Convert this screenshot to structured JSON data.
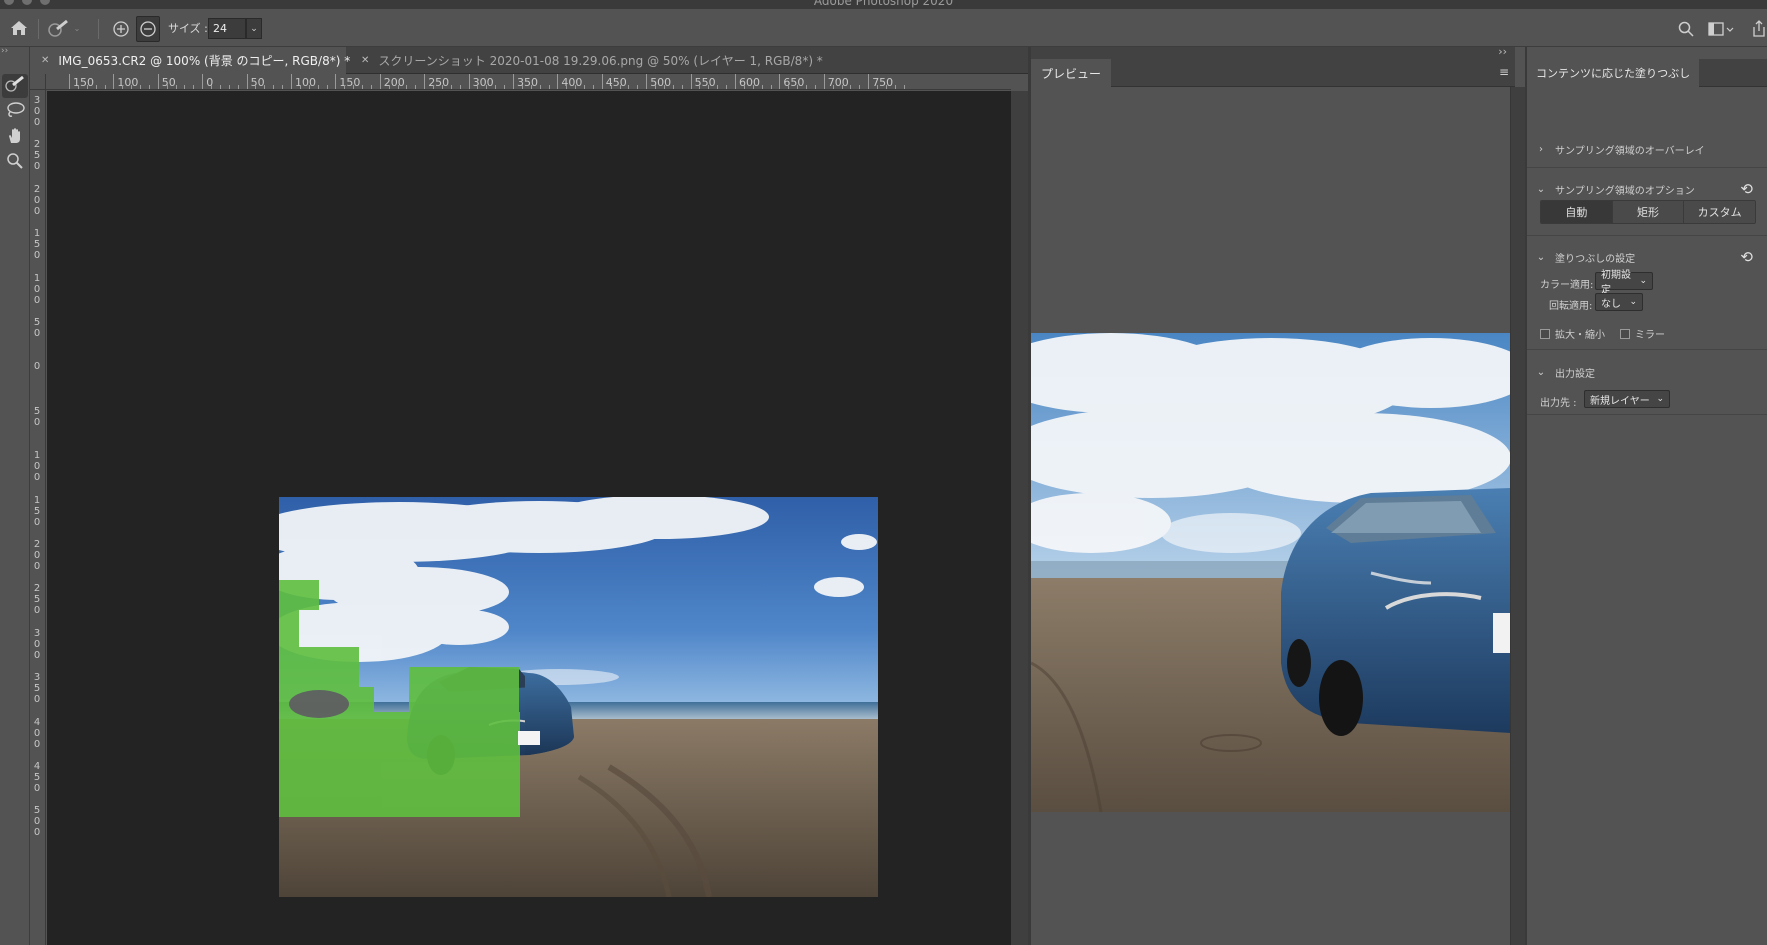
{
  "window": {
    "title": "Adobe Photoshop 2020"
  },
  "options_bar": {
    "home_icon": "home-icon",
    "brush_preset_icon": "brush-preset-icon",
    "add_mode_icon": "add-to-selection-icon",
    "subtract_mode_icon": "subtract-from-selection-icon",
    "size_label": "サイズ :",
    "size_value": "24",
    "search_icon": "search-icon",
    "workspace_icon": "workspace-icon",
    "share_icon": "share-icon"
  },
  "tools": [
    {
      "name": "sampling-brush-tool",
      "icon": "brush-icon",
      "active": true
    },
    {
      "name": "lasso-tool",
      "icon": "lasso-icon",
      "active": false
    },
    {
      "name": "hand-tool",
      "icon": "hand-icon",
      "active": false
    },
    {
      "name": "zoom-tool",
      "icon": "magnifier-icon",
      "active": false
    }
  ],
  "tabs": [
    {
      "label": "IMG_0653.CR2 @ 100% (背景 のコピー, RGB/8*) *",
      "active": true
    },
    {
      "label": "スクリーンショット 2020-01-08 19.29.06.png @ 50% (レイヤー 1, RGB/8*) *",
      "active": false
    }
  ],
  "ruler": {
    "top_labels": [
      "150",
      "100",
      "50",
      "0",
      "50",
      "100",
      "150",
      "200",
      "250",
      "300",
      "350",
      "400",
      "450",
      "500",
      "550",
      "600",
      "650",
      "700",
      "750"
    ],
    "left_labels": [
      "300",
      "250",
      "200",
      "150",
      "100",
      "50",
      "0",
      "50",
      "100",
      "150",
      "200",
      "250",
      "300",
      "350",
      "400",
      "450",
      "500"
    ]
  },
  "preview": {
    "tab_label": "プレビュー",
    "menu_icon": "panel-menu-icon"
  },
  "panel": {
    "title": "コンテンツに応じた塗りつぶし",
    "sampling_overlay": "サンプリング領域のオーバーレイ",
    "sampling_options": "サンプリング領域のオプション",
    "sampling_modes": [
      "自動",
      "矩形",
      "カスタム"
    ],
    "selected_mode": "自動",
    "fill_settings": "塗りつぶしの設定",
    "color_adapt_label": "カラー適用:",
    "color_adapt_value": "初期設定",
    "rotation_adapt_label": "回転適用:",
    "rotation_adapt_value": "なし",
    "scale_label": "拡大・縮小",
    "mirror_label": "ミラー",
    "output_settings": "出力設定",
    "output_label": "出力先 :",
    "output_value": "新規レイヤー",
    "reset_icon": "reset-icon"
  },
  "colors": {
    "overlay_green": "#5fbf3f",
    "canvas_bg": "#232323",
    "ui_bg": "#535353"
  }
}
